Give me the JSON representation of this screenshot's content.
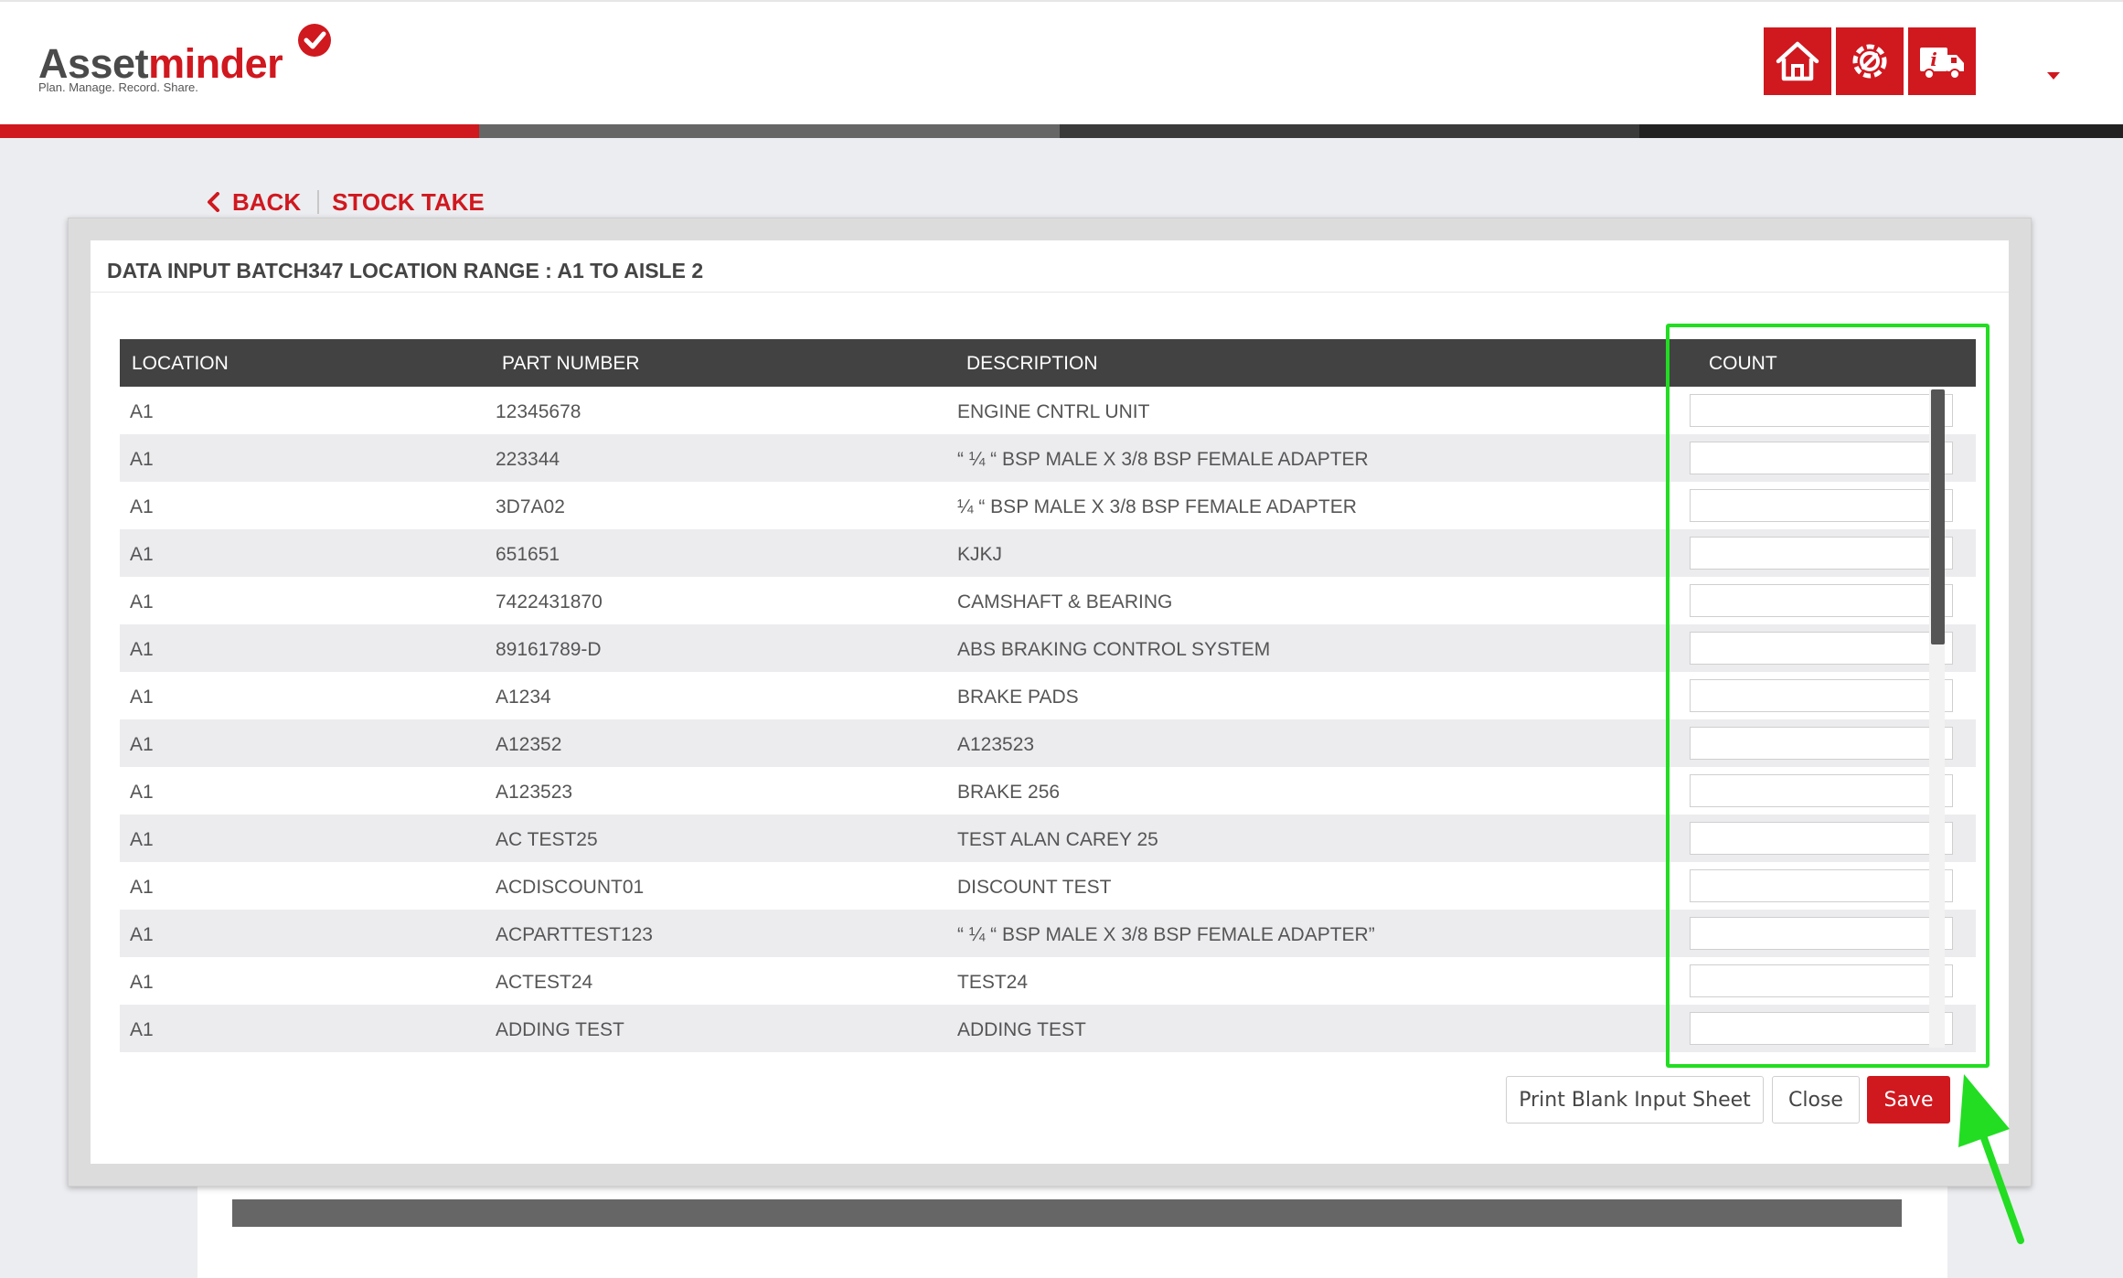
{
  "header": {
    "logo_word_1": "Asset",
    "logo_word_2": "minder",
    "logo_tagline": "Plan. Manage. Record. Share.",
    "icons": [
      "home-icon",
      "settings-icon",
      "truck-info-icon"
    ],
    "accent_color": "#d0181f",
    "progress_colors": [
      "#d0181f",
      "#666666",
      "#3a3a3a",
      "#222222"
    ]
  },
  "breadcrumb": {
    "back_label": "BACK",
    "current_label": "STOCK TAKE"
  },
  "modal": {
    "title": "DATA INPUT BATCH347 LOCATION RANGE : A1 TO AISLE 2",
    "columns": {
      "location": "LOCATION",
      "part_number": "PART NUMBER",
      "description": "DESCRIPTION",
      "count": "COUNT"
    },
    "rows": [
      {
        "location": "A1",
        "part_number": "12345678",
        "description": "ENGINE CNTRL UNIT",
        "count": ""
      },
      {
        "location": "A1",
        "part_number": "223344",
        "description": "“ ¼ “ BSP MALE X 3/8 BSP FEMALE ADAPTER",
        "count": ""
      },
      {
        "location": "A1",
        "part_number": "3D7A02",
        "description": "¼ “ BSP MALE X 3/8 BSP FEMALE ADAPTER",
        "count": ""
      },
      {
        "location": "A1",
        "part_number": "651651",
        "description": "KJKJ",
        "count": ""
      },
      {
        "location": "A1",
        "part_number": "7422431870",
        "description": "CAMSHAFT & BEARING",
        "count": ""
      },
      {
        "location": "A1",
        "part_number": "89161789-D",
        "description": "ABS BRAKING CONTROL SYSTEM",
        "count": ""
      },
      {
        "location": "A1",
        "part_number": "A1234",
        "description": "BRAKE PADS",
        "count": ""
      },
      {
        "location": "A1",
        "part_number": "A12352",
        "description": "A123523",
        "count": ""
      },
      {
        "location": "A1",
        "part_number": "A123523",
        "description": "BRAKE 256",
        "count": ""
      },
      {
        "location": "A1",
        "part_number": "AC TEST25",
        "description": "TEST ALAN CAREY 25",
        "count": ""
      },
      {
        "location": "A1",
        "part_number": "ACDISCOUNT01",
        "description": "DISCOUNT TEST",
        "count": ""
      },
      {
        "location": "A1",
        "part_number": "ACPARTTEST123",
        "description": "“ ¼ “ BSP MALE X 3/8 BSP FEMALE ADAPTER”",
        "count": ""
      },
      {
        "location": "A1",
        "part_number": "ACTEST24",
        "description": "TEST24",
        "count": ""
      },
      {
        "location": "A1",
        "part_number": "ADDING TEST",
        "description": "ADDING TEST",
        "count": ""
      }
    ],
    "buttons": {
      "print": "Print Blank Input Sheet",
      "close": "Close",
      "save": "Save"
    }
  },
  "annotation": {
    "highlight_color": "#22dd22"
  }
}
